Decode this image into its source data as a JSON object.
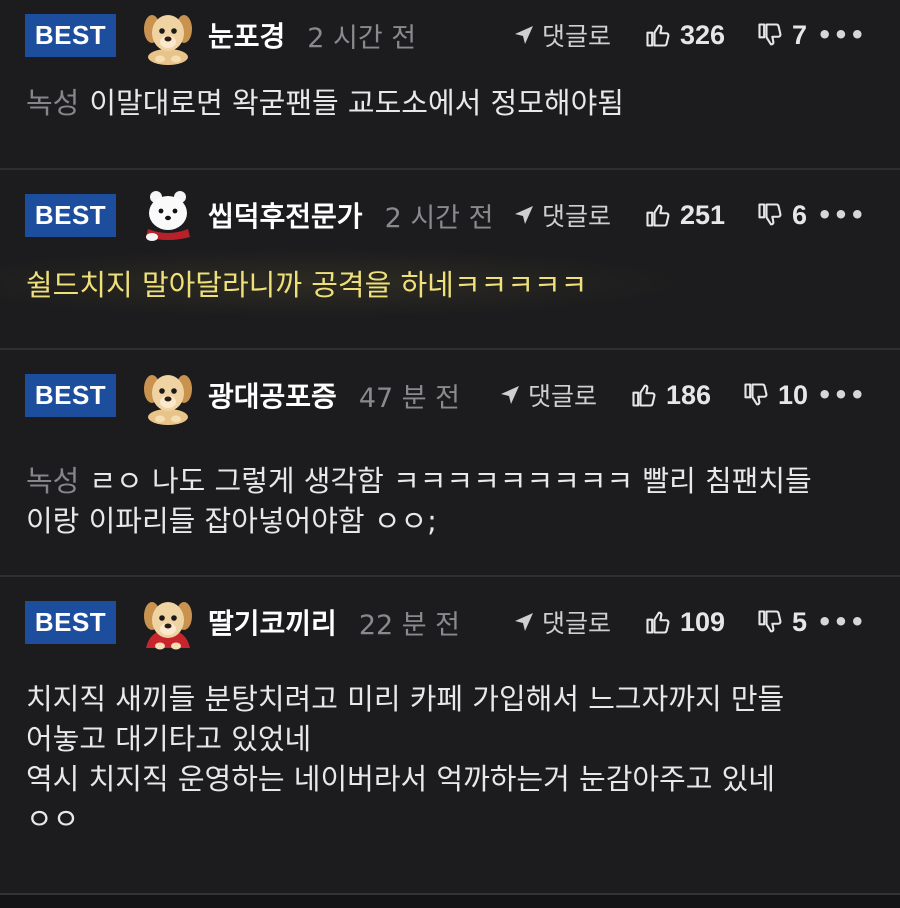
{
  "comments": [
    {
      "badge": "BEST",
      "avatar": "puppy-icon",
      "nickname": "눈포경",
      "time": "2 시간 전",
      "reply_label": "댓글로",
      "likes": "326",
      "dislikes": "7",
      "more": "•••",
      "prefix": "녹성",
      "text": "이말대로면 왁굳팬들 교도소에서 정모해야됨"
    },
    {
      "badge": "BEST",
      "avatar": "polar-bear-icon",
      "nickname": "씹덕후전문가",
      "time": "2 시간 전",
      "reply_label": "댓글로",
      "likes": "251",
      "dislikes": "6",
      "more": "•••",
      "text": "쉴드치지 말아달라니까 공격을 하네ㅋㅋㅋㅋㅋ"
    },
    {
      "badge": "BEST",
      "avatar": "puppy-icon",
      "nickname": "광대공포증",
      "time": "47 분 전",
      "reply_label": "댓글로",
      "likes": "186",
      "dislikes": "10",
      "more": "•••",
      "prefix": "녹성",
      "text_line1": "ㄹㅇ 나도 그렇게 생각함 ㅋㅋㅋㅋㅋㅋㅋㅋㅋ 빨리 침팬치들",
      "text_line2": "이랑 이파리들 잡아넣어야함 ㅇㅇ;"
    },
    {
      "badge": "BEST",
      "avatar": "puppy-cape-icon",
      "nickname": "딸기코끼리",
      "time": "22 분 전",
      "reply_label": "댓글로",
      "likes": "109",
      "dislikes": "5",
      "more": "•••",
      "text_line1": "치지직 새끼들 분탕치려고 미리 카페 가입해서 느그자까지 만들",
      "text_line2": "어놓고 대기타고 있었네",
      "text_line3": "역시 치지직 운영하는 네이버라서 억까하는거 눈감아주고 있네",
      "text_line4": "ㅇㅇ"
    }
  ],
  "colors": {
    "background": "#1c1c1e",
    "badge": "#1d4e9e",
    "highlight_text": "#efe07a",
    "muted": "#8a8a8e"
  }
}
